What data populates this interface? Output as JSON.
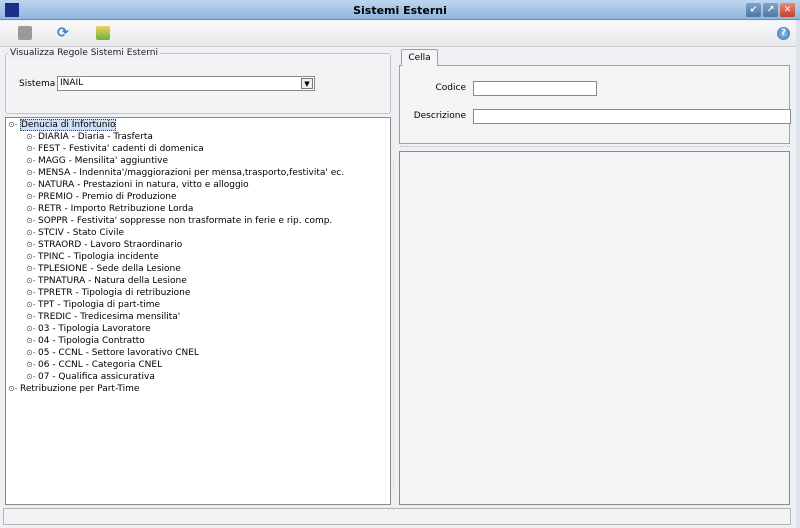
{
  "window": {
    "title": "Sistemi Esterni",
    "controls": [
      "minimize",
      "maximize",
      "close"
    ]
  },
  "toolbar": {
    "buttons": [
      {
        "name": "save-icon",
        "color": "#9a9a9a"
      },
      {
        "name": "refresh-icon",
        "color": "#3d7fc9"
      },
      {
        "name": "export-icon",
        "color": "#6bb33a"
      }
    ],
    "help": "?"
  },
  "filter": {
    "group_label": "Visualizza Regole Sistemi Esterni",
    "sistema_label": "Sistema",
    "sistema_value": "INAIL"
  },
  "tree": {
    "root": "Denucia di Infortunio",
    "children": [
      "DIARIA - Diaria - Trasferta",
      "FEST - Festivita' cadenti di domenica",
      "MAGG - Mensilita' aggiuntive",
      "MENSA - Indennita'/maggiorazioni per mensa,trasporto,festivita' ec.",
      "NATURA - Prestazioni in natura, vitto e alloggio",
      "PREMIO - Premio di Produzione",
      "RETR - Importo Retribuzione Lorda",
      "SOPPR - Festivita' soppresse non trasformate in ferie e rip. comp.",
      "STCIV - Stato Civile",
      "STRAORD - Lavoro Straordinario",
      "TPINC - Tipologia incidente",
      "TPLESIONE - Sede della Lesione",
      "TPNATURA - Natura della Lesione",
      "TPRETR - Tipologia di retribuzione",
      "TPT - Tipologia di part-time",
      "TREDIC - Tredicesima mensilita'",
      "03 - Tipologia Lavoratore",
      "04 - Tipologia Contratto",
      "05 - CCNL - Settore lavorativo CNEL",
      "06 - CCNL - Categoria CNEL",
      "07 - Qualifica assicurativa"
    ],
    "root2": "Retribuzione per Part-Time"
  },
  "detail": {
    "tab": "Cella",
    "codice_label": "Codice",
    "codice_value": "",
    "descrizione_label": "Descrizione",
    "descrizione_value": ""
  }
}
